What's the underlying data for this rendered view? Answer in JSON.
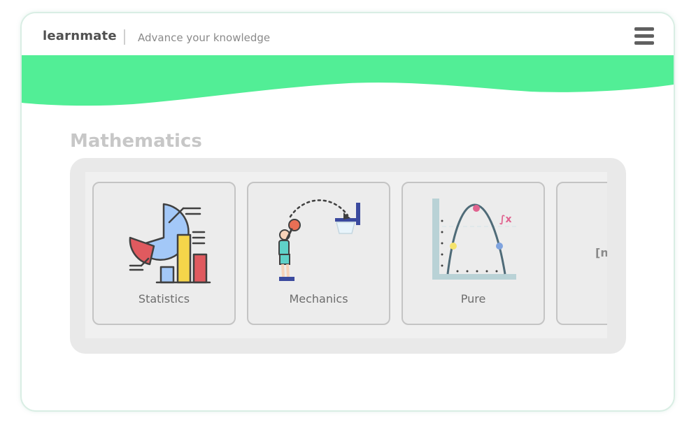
{
  "header": {
    "brand": "learnmate",
    "tagline": "Advance your knowledge",
    "menu_icon": "hamburger-menu-icon"
  },
  "colors": {
    "accent": "#52ee96",
    "title": "#c7c7c7",
    "panel": "#e9e9e9",
    "card_border": "#c4c4c4"
  },
  "section": {
    "title": "Mathematics",
    "cards": [
      {
        "label": "Statistics",
        "icon": "statistics-chart-icon"
      },
      {
        "label": "Mechanics",
        "icon": "basketball-player-icon"
      },
      {
        "label": "Pure",
        "icon": "parabola-graph-icon"
      },
      {
        "label": "[n",
        "icon": ""
      }
    ]
  }
}
